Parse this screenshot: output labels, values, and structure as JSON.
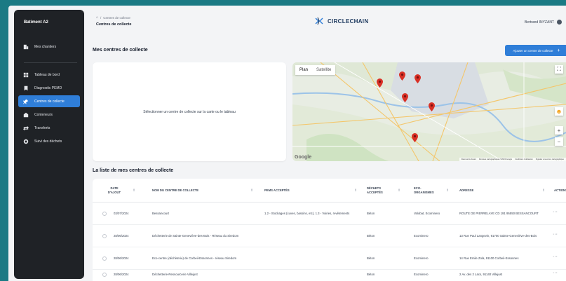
{
  "sidebar": {
    "title": "Batiment A2",
    "items": [
      {
        "label": "Mes chantiers",
        "icon": "building-icon"
      },
      {
        "label": "Tableau de bord",
        "icon": "dashboard-icon"
      },
      {
        "label": "Diagnostic PEMD",
        "icon": "bookmark-icon"
      },
      {
        "label": "Centres de collecte",
        "icon": "pin-icon",
        "active": true
      },
      {
        "label": "Conteneurs",
        "icon": "container-icon"
      },
      {
        "label": "Transferts",
        "icon": "transfer-icon"
      },
      {
        "label": "Suivi des déchets",
        "icon": "tracking-icon"
      }
    ]
  },
  "header": {
    "breadcrumb_sep": "/",
    "breadcrumb": "Centres de collecte",
    "title": "Centres de collecte",
    "logo": "CIRCLECHAIN",
    "user": "Bertrand INYZANT"
  },
  "section1": {
    "title": "Mes centres de collecte",
    "add_button": "Ajouter un centre de collecte",
    "add_icon": "+",
    "hint": "Sélectionner un centre de collecte sur la carte ou le tableau"
  },
  "map": {
    "tab_plan": "Plan",
    "tab_satellite": "Satellite",
    "google": "Google",
    "footer": [
      "Raccourcis clavier",
      "Données cartographiques ©2024 Google",
      "Conditions d'utilisation",
      "Signaler une erreur cartographique"
    ],
    "pin_color": "#d93025"
  },
  "section2": {
    "title": "La liste de mes centres de collecte"
  },
  "table": {
    "headers": {
      "date": [
        "DATE",
        "D'AJOUT"
      ],
      "name": "NOM DU CENTRE DE COLLECTE",
      "pems": "PEMS ACCEPTÉS",
      "dechets": [
        "DÉCHETS",
        "ACCEPTÉS"
      ],
      "eco": [
        "ECO-",
        "ORGANISMES"
      ],
      "adresse": "ADRESSE",
      "actions": "ACTIONS"
    },
    "rows": [
      {
        "date": "03/07/2024",
        "name": "Bessancourt",
        "pems": "1.2 - Stockages (cuves, bassins, etc), 1.3 - Voiries, revêtements",
        "dechets": "Béton",
        "eco": "Valobat, Ecominero",
        "adresse": "ROUTE DE PIERRELAYE CD 191 95550 BESSANCOURT"
      },
      {
        "date": "28/06/2024",
        "name": "Déchetterie de Sainte-Geneviève-des-Bois - Réseau du Siredom",
        "pems": "",
        "dechets": "Béton",
        "eco": "Ecominero",
        "adresse": "13 Rue Paul Langevin, 91700 Sainte-Geneviève-des-Bois"
      },
      {
        "date": "28/06/2024",
        "name": "Eco-centre (déchèterie) de Corbeil-Essonnes - réseau Siredom",
        "pems": "",
        "dechets": "Béton",
        "eco": "Ecominero",
        "adresse": "14 Rue Emile Zola, 91100 Corbeil-Essonnes"
      },
      {
        "date": "28/06/2024",
        "name": "Déchetterie-Ressourcerie Villejust",
        "pems": "",
        "dechets": "Béton",
        "eco": "Ecominero",
        "adresse": "2 Av. des 2 Lacs, 91140 Villejust"
      }
    ],
    "row_action": "···"
  }
}
